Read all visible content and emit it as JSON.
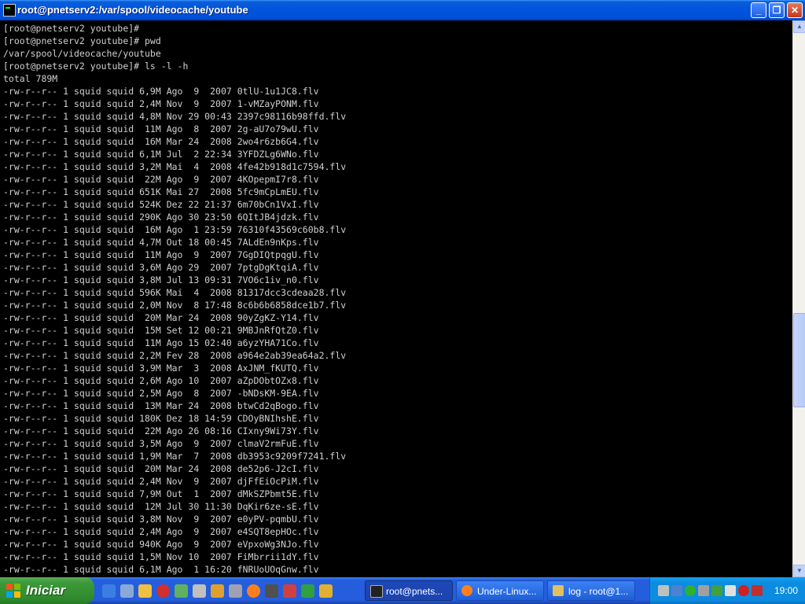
{
  "window": {
    "title": "root@pnetserv2:/var/spool/videocache/youtube",
    "minimize_label": "_",
    "maximize_label": "❐",
    "close_label": "✕"
  },
  "terminal": {
    "lines": [
      "[root@pnetserv2 youtube]#",
      "[root@pnetserv2 youtube]# pwd",
      "/var/spool/videocache/youtube",
      "[root@pnetserv2 youtube]# ls -l -h",
      "total 789M",
      "-rw-r--r-- 1 squid squid 6,9M Ago  9  2007 0tlU-1u1JC8.flv",
      "-rw-r--r-- 1 squid squid 2,4M Nov  9  2007 1-vMZayPONM.flv",
      "-rw-r--r-- 1 squid squid 4,8M Nov 29 00:43 2397c98116b98ffd.flv",
      "-rw-r--r-- 1 squid squid  11M Ago  8  2007 2g-aU7o79wU.flv",
      "-rw-r--r-- 1 squid squid  16M Mar 24  2008 2wo4r6zb6G4.flv",
      "-rw-r--r-- 1 squid squid 6,1M Jul  2 22:34 3YFDZLg6WNo.flv",
      "-rw-r--r-- 1 squid squid 3,2M Mai  4  2008 4fe42b918d1c7594.flv",
      "-rw-r--r-- 1 squid squid  22M Ago  9  2007 4KOpepmI7r8.flv",
      "-rw-r--r-- 1 squid squid 651K Mai 27  2008 5fc9mCpLmEU.flv",
      "-rw-r--r-- 1 squid squid 524K Dez 22 21:37 6m70bCn1VxI.flv",
      "-rw-r--r-- 1 squid squid 290K Ago 30 23:50 6QItJB4jdzk.flv",
      "-rw-r--r-- 1 squid squid  16M Ago  1 23:59 76310f43569c60b8.flv",
      "-rw-r--r-- 1 squid squid 4,7M Out 18 00:45 7ALdEn9nKps.flv",
      "-rw-r--r-- 1 squid squid  11M Ago  9  2007 7GgDIQtpqgU.flv",
      "-rw-r--r-- 1 squid squid 3,6M Ago 29  2007 7ptgDgKtqiA.flv",
      "-rw-r--r-- 1 squid squid 3,8M Jul 13 09:31 7VO6c1iv_n0.flv",
      "-rw-r--r-- 1 squid squid 596K Mai  4  2008 81317dcc3cdeaa28.flv",
      "-rw-r--r-- 1 squid squid 2,0M Nov  8 17:48 8c6b6b6858dce1b7.flv",
      "-rw-r--r-- 1 squid squid  20M Mar 24  2008 90yZgKZ-Y14.flv",
      "-rw-r--r-- 1 squid squid  15M Set 12 00:21 9MBJnRfQtZ0.flv",
      "-rw-r--r-- 1 squid squid  11M Ago 15 02:40 a6yzYHA71Co.flv",
      "-rw-r--r-- 1 squid squid 2,2M Fev 28  2008 a964e2ab39ea64a2.flv",
      "-rw-r--r-- 1 squid squid 3,9M Mar  3  2008 AxJNM_fKUTQ.flv",
      "-rw-r--r-- 1 squid squid 2,6M Ago 10  2007 aZpDObtOZx8.flv",
      "-rw-r--r-- 1 squid squid 2,5M Ago  8  2007 -bNDsKM-9EA.flv",
      "-rw-r--r-- 1 squid squid  13M Mar 24  2008 btwCd2qBogo.flv",
      "-rw-r--r-- 1 squid squid 180K Dez 18 14:59 CDOyBNIhshE.flv",
      "-rw-r--r-- 1 squid squid  22M Ago 26 08:16 CIxny9Wi73Y.flv",
      "-rw-r--r-- 1 squid squid 3,5M Ago  9  2007 clmaV2rmFuE.flv",
      "-rw-r--r-- 1 squid squid 1,9M Mar  7  2008 db3953c9209f7241.flv",
      "-rw-r--r-- 1 squid squid  20M Mar 24  2008 de52p6-J2cI.flv",
      "-rw-r--r-- 1 squid squid 2,4M Nov  9  2007 djFfEiOcPiM.flv",
      "-rw-r--r-- 1 squid squid 7,9M Out  1  2007 dMkSZPbmt5E.flv",
      "-rw-r--r-- 1 squid squid  12M Jul 30 11:30 DqKir6ze-sE.flv",
      "-rw-r--r-- 1 squid squid 3,8M Nov  9  2007 e0yPV-pqmbU.flv",
      "-rw-r--r-- 1 squid squid 2,4M Ago  9  2007 e4SQT8epHOc.flv",
      "-rw-r--r-- 1 squid squid 940K Ago  9  2007 eVpxoWg3NJo.flv",
      "-rw-r--r-- 1 squid squid 1,5M Nov 10  2007 FiMbrrii1dY.flv",
      "-rw-r--r-- 1 squid squid 6,1M Ago  1 16:20 fNRUoUOqGnw.flv"
    ]
  },
  "scrollbar": {
    "up_arrow": "▲",
    "down_arrow": "▼"
  },
  "taskbar": {
    "start_label": "Iniciar",
    "tasks": [
      {
        "label": "root@pnets...",
        "icon": "putty-icon"
      },
      {
        "label": "Under-Linux...",
        "icon": "firefox-icon"
      },
      {
        "label": "log - root@1...",
        "icon": "ftp-icon"
      }
    ],
    "clock": "19:00"
  },
  "colors": {
    "titlebar": "#0155dc",
    "terminal_bg": "#000000",
    "terminal_fg": "#d0d0d0",
    "taskbar": "#245edc",
    "start_button": "#3c9a3a",
    "tray": "#0c8ce0"
  }
}
